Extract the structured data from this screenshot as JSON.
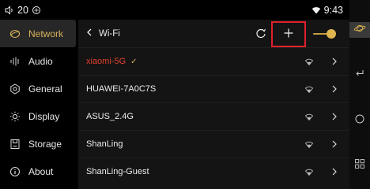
{
  "status": {
    "left_text": "20",
    "time": "9:43",
    "volume_icon": "volume-icon",
    "settings_icon": "settings-status-icon",
    "wifi_icon": "wifi-status-icon"
  },
  "sidebar": {
    "items": [
      {
        "label": "Network",
        "icon": "globe-icon",
        "active": true
      },
      {
        "label": "Audio",
        "icon": "audio-bars-icon",
        "active": false
      },
      {
        "label": "General",
        "icon": "gear-icon",
        "active": false
      },
      {
        "label": "Display",
        "icon": "sun-icon",
        "active": false
      },
      {
        "label": "Storage",
        "icon": "storage-icon",
        "active": false
      },
      {
        "label": "About",
        "icon": "info-icon",
        "active": false
      }
    ]
  },
  "header": {
    "back_label": "Wi-Fi",
    "wifi_enabled": true
  },
  "networks": [
    {
      "ssid": "xiaomi-5G",
      "connected": true,
      "check": "✓"
    },
    {
      "ssid": "HUAWEI-7A0C7S",
      "connected": false
    },
    {
      "ssid": "ASUS_2.4G",
      "connected": false
    },
    {
      "ssid": "ShanLing",
      "connected": false
    },
    {
      "ssid": "ShanLing-Guest",
      "connected": false
    }
  ],
  "colors": {
    "accent": "#d7b25a",
    "connected": "#e0402c",
    "highlight": "#e0212b",
    "panel": "#141414"
  }
}
